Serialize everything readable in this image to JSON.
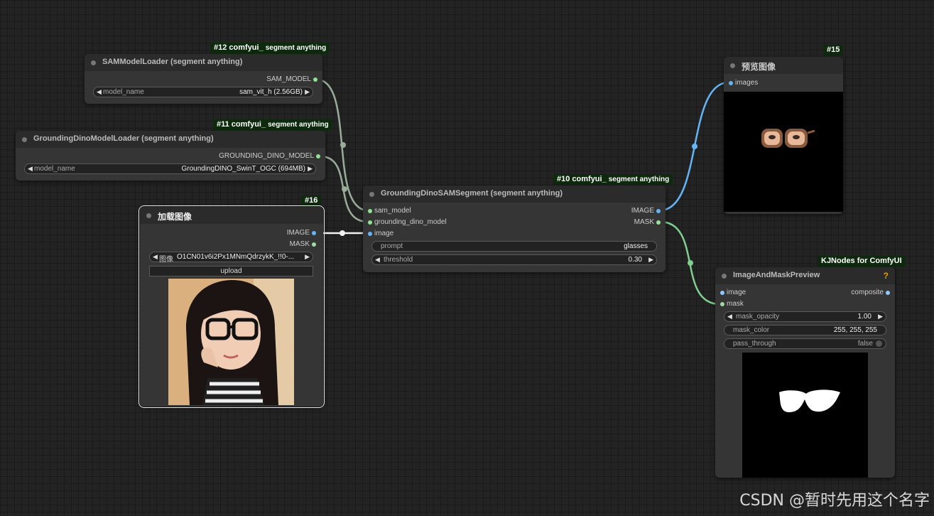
{
  "canvas": {
    "background": "#232323"
  },
  "badges": {
    "n12": {
      "id": "#12 comfyui_",
      "pack": "segment anything"
    },
    "n11": {
      "id": "#11 comfyui_",
      "pack": "segment anything"
    },
    "n10": {
      "id": "#10 comfyui_",
      "pack": "segment anything"
    },
    "n15": {
      "id": "#15"
    },
    "n16": {
      "id": "#16"
    },
    "kj": {
      "id": "KJNodes for ComfyUI"
    }
  },
  "sam_loader": {
    "title": "SAMModelLoader (segment anything)",
    "output": "SAM_MODEL",
    "widget_label": "model_name",
    "widget_value": "sam_vit_h (2.56GB)"
  },
  "dino_loader": {
    "title": "GroundingDinoModelLoader (segment anything)",
    "output": "GROUNDING_DINO_MODEL",
    "widget_label": "model_name",
    "widget_value": "GroundingDINO_SwinT_OGC (694MB)"
  },
  "load_image": {
    "title": "加载图像",
    "outputs": [
      "IMAGE",
      "MASK"
    ],
    "image_label": "图像",
    "image_value": "O1CN01v6i2Px1MNmQdrzykK_!!0-...",
    "upload_label": "upload",
    "preview_icon": "portrait-photo-icon"
  },
  "segment": {
    "title": "GroundingDinoSAMSegment (segment anything)",
    "inputs": [
      "sam_model",
      "grounding_dino_model",
      "image"
    ],
    "outputs": [
      "IMAGE",
      "MASK"
    ],
    "prompt_label": "prompt",
    "prompt_value": "glasses",
    "threshold_label": "threshold",
    "threshold_value": "0.30"
  },
  "preview": {
    "title": "预览图像",
    "input": "images",
    "preview_icon": "glasses-cutout-icon"
  },
  "mask_preview": {
    "title": "ImageAndMaskPreview",
    "help": "?",
    "inputs": [
      "image",
      "mask"
    ],
    "output": "composite",
    "opacity_label": "mask_opacity",
    "opacity_value": "1.00",
    "color_label": "mask_color",
    "color_value": "255, 255, 255",
    "pass_label": "pass_through",
    "pass_value": "false",
    "preview_icon": "glasses-mask-icon"
  },
  "watermark": "CSDN @暂时先用这个名字",
  "colors": {
    "link_image": "#64b5f6",
    "link_mask": "#7fcf8f",
    "link_model": "#9db49d",
    "badge": "#0d2a0d"
  }
}
